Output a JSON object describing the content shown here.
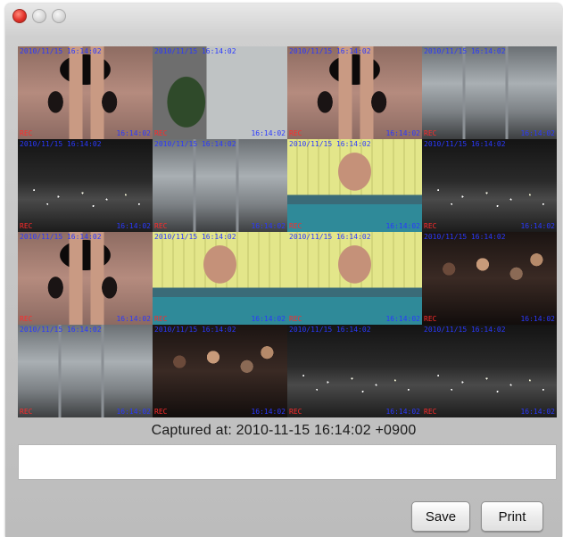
{
  "window": {
    "controls": [
      "close",
      "minimize",
      "zoom"
    ]
  },
  "tiles": [
    {
      "scene": "dancer",
      "osd_top": "2010/11/15 16:14:02",
      "osd_bl": "REC",
      "osd_br": "16:14:02"
    },
    {
      "scene": "lobby",
      "osd_top": "2010/11/15 16:14:02",
      "osd_bl": "REC",
      "osd_br": "16:14:02"
    },
    {
      "scene": "dancer",
      "osd_top": "2010/11/15 16:14:02",
      "osd_bl": "REC",
      "osd_br": "16:14:02"
    },
    {
      "scene": "office",
      "osd_top": "2010/11/15 16:14:02",
      "osd_bl": "REC",
      "osd_br": "16:14:02"
    },
    {
      "scene": "night",
      "osd_top": "2010/11/15 16:14:02",
      "osd_bl": "REC",
      "osd_br": "16:14:02"
    },
    {
      "scene": "office",
      "osd_top": "2010/11/15 16:14:02",
      "osd_bl": "REC",
      "osd_br": "16:14:02"
    },
    {
      "scene": "swimmer",
      "osd_top": "2010/11/15 16:14:02",
      "osd_bl": "REC",
      "osd_br": "16:14:02"
    },
    {
      "scene": "night",
      "osd_top": "2010/11/15 16:14:02",
      "osd_bl": "REC",
      "osd_br": "16:14:02"
    },
    {
      "scene": "dancer",
      "osd_top": "2010/11/15 16:14:02",
      "osd_bl": "REC",
      "osd_br": "16:14:02"
    },
    {
      "scene": "swimmer",
      "osd_top": "2010/11/15 16:14:02",
      "osd_bl": "REC",
      "osd_br": "16:14:02"
    },
    {
      "scene": "swimmer",
      "osd_top": "2010/11/15 16:14:02",
      "osd_bl": "REC",
      "osd_br": "16:14:02"
    },
    {
      "scene": "crowd",
      "osd_top": "2010/11/15 16:14:02",
      "osd_bl": "REC",
      "osd_br": "16:14:02"
    },
    {
      "scene": "office",
      "osd_top": "2010/11/15 16:14:02",
      "osd_bl": "REC",
      "osd_br": "16:14:02"
    },
    {
      "scene": "crowd",
      "osd_top": "2010/11/15 16:14:02",
      "osd_bl": "REC",
      "osd_br": "16:14:02"
    },
    {
      "scene": "night",
      "osd_top": "2010/11/15 16:14:02",
      "osd_bl": "REC",
      "osd_br": "16:14:02"
    },
    {
      "scene": "night",
      "osd_top": "2010/11/15 16:14:02",
      "osd_bl": "REC",
      "osd_br": "16:14:02"
    }
  ],
  "caption": "Captured at: 2010-11-15 16:14:02 +0900",
  "comment_field": {
    "value": ""
  },
  "buttons": {
    "save_label": "Save",
    "print_label": "Print"
  }
}
